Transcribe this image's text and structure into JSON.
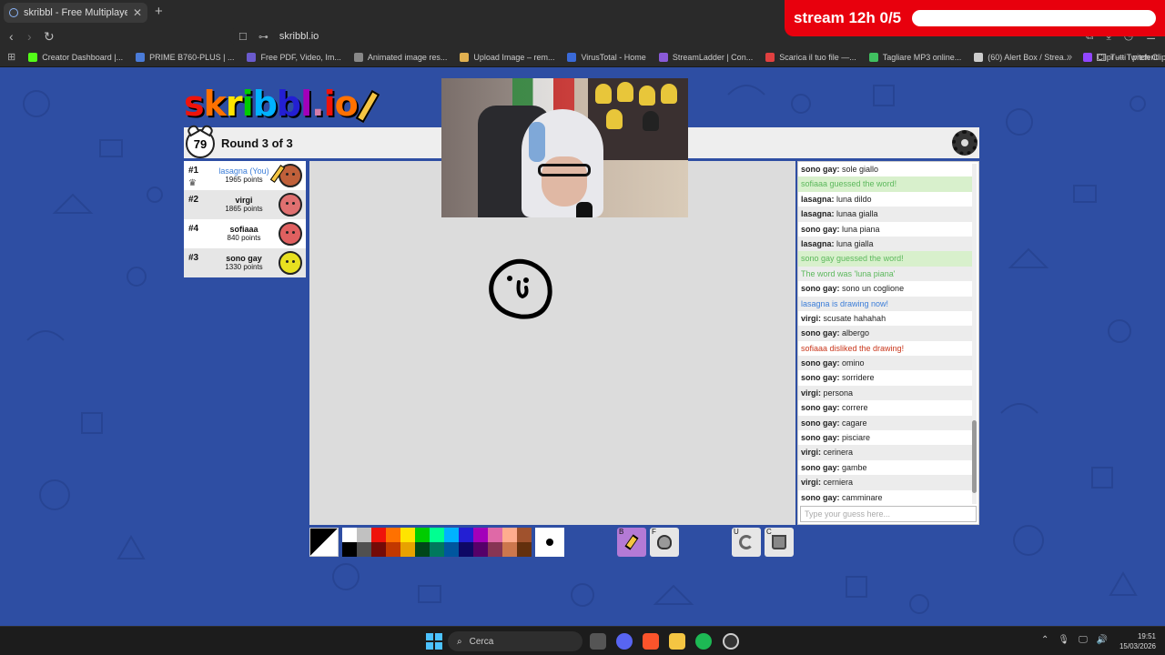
{
  "browser": {
    "tab_title": "skribbl - Free Multiplayer Drawing",
    "tab_close": "✕",
    "new_tab": "+",
    "url": "skribbl.io",
    "bookmarks": [
      {
        "label": "Creator Dashboard |...",
        "color": "#53fc18"
      },
      {
        "label": "PRIME B760-PLUS | ...",
        "color": "#4a7bd8"
      },
      {
        "label": "Free PDF, Video, Im...",
        "color": "#6a5acd"
      },
      {
        "label": "Animated image res...",
        "color": "#888888"
      },
      {
        "label": "Upload Image – rem...",
        "color": "#e0b050"
      },
      {
        "label": "VirusTotal - Home",
        "color": "#3a6ad8"
      },
      {
        "label": "StreamLadder | Con...",
        "color": "#8a5ad8"
      },
      {
        "label": "Scarica il tuo file —...",
        "color": "#e04040"
      },
      {
        "label": "Tagliare MP3 online...",
        "color": "#40c060"
      },
      {
        "label": "(60) Alert Box / Strea...",
        "color": "#cccccc"
      },
      {
        "label": "Clipr — Twitch Clip...",
        "color": "#9146ff"
      }
    ],
    "bookmarks_more": "»",
    "bookmarks_folder": "Tutti i preferiti"
  },
  "stream_overlay": {
    "text": "stream 12h 0/5",
    "progress": 0
  },
  "game": {
    "logo": [
      "s",
      "k",
      "r",
      "i",
      "b",
      "b",
      "l",
      ".",
      "i",
      "o"
    ],
    "logo_colors": [
      "#ef130b",
      "#ff7100",
      "#ffe400",
      "#00cc00",
      "#00b2ff",
      "#231fd3",
      "#a300ba",
      "#d37caa",
      "#ef130b",
      "#ff7100"
    ],
    "timer": "79",
    "round_text": "Round 3 of 3",
    "players": [
      {
        "rank": "#1",
        "name": "lasagna (You)",
        "points": "1965 points",
        "color": "#c0603a",
        "you": true
      },
      {
        "rank": "#2",
        "name": "virgi",
        "points": "1865 points",
        "color": "#e07070"
      },
      {
        "rank": "#4",
        "name": "sofiaaa",
        "points": "840 points",
        "color": "#e06060"
      },
      {
        "rank": "#3",
        "name": "sono gay",
        "points": "1330 points",
        "color": "#e8e020"
      }
    ],
    "chat": [
      {
        "user": "sono gay",
        "text": "sole giallo",
        "type": "normal"
      },
      {
        "user": "",
        "text": "sofiaaa guessed the word!",
        "type": "guess"
      },
      {
        "user": "lasagna",
        "text": "luna dildo",
        "type": "normal"
      },
      {
        "user": "lasagna",
        "text": "lunaa gialla",
        "type": "normal"
      },
      {
        "user": "sono gay",
        "text": "luna piana",
        "type": "normal"
      },
      {
        "user": "lasagna",
        "text": "luna gialla",
        "type": "normal"
      },
      {
        "user": "",
        "text": "sono gay guessed the word!",
        "type": "guess"
      },
      {
        "user": "",
        "text": "The word was 'luna piana'",
        "type": "word"
      },
      {
        "user": "sono gay",
        "text": "sono un coglione",
        "type": "normal"
      },
      {
        "user": "",
        "text": "lasagna is drawing now!",
        "type": "draw"
      },
      {
        "user": "virgi",
        "text": "scusate hahahah",
        "type": "normal"
      },
      {
        "user": "sono gay",
        "text": "albergo",
        "type": "normal"
      },
      {
        "user": "",
        "text": "sofiaaa disliked the drawing!",
        "type": "dislike"
      },
      {
        "user": "sono gay",
        "text": "omino",
        "type": "normal"
      },
      {
        "user": "sono gay",
        "text": "sorridere",
        "type": "normal"
      },
      {
        "user": "virgi",
        "text": "persona",
        "type": "normal"
      },
      {
        "user": "sono gay",
        "text": "correre",
        "type": "normal"
      },
      {
        "user": "sono gay",
        "text": "cagare",
        "type": "normal"
      },
      {
        "user": "sono gay",
        "text": "pisciare",
        "type": "normal"
      },
      {
        "user": "virgi",
        "text": "cerinera",
        "type": "normal"
      },
      {
        "user": "sono gay",
        "text": "gambe",
        "type": "normal"
      },
      {
        "user": "virgi",
        "text": "cerniera",
        "type": "normal"
      },
      {
        "user": "sono gay",
        "text": "camminare",
        "type": "normal"
      }
    ],
    "chat_placeholder": "Type your guess here...",
    "palette_top": [
      "#ffffff",
      "#c1c1c1",
      "#ef130b",
      "#ff7100",
      "#ffe400",
      "#00cc00",
      "#00ff91",
      "#00b2ff",
      "#231fd3",
      "#a300ba",
      "#df69a7",
      "#ffac8e",
      "#a0522d"
    ],
    "palette_bottom": [
      "#000000",
      "#505050",
      "#740b07",
      "#c23800",
      "#e8a200",
      "#004619",
      "#00785d",
      "#00569e",
      "#0e0865",
      "#550069",
      "#873554",
      "#cc774d",
      "#63300d"
    ],
    "tools": [
      {
        "key": "B",
        "name": "pencil",
        "selected": true
      },
      {
        "key": "F",
        "name": "fill",
        "selected": false
      },
      {
        "key": "U",
        "name": "undo",
        "selected": false
      },
      {
        "key": "C",
        "name": "clear",
        "selected": false
      }
    ]
  },
  "taskbar": {
    "search": "Cerca",
    "time": "19:51",
    "date": "15/03/2026"
  }
}
